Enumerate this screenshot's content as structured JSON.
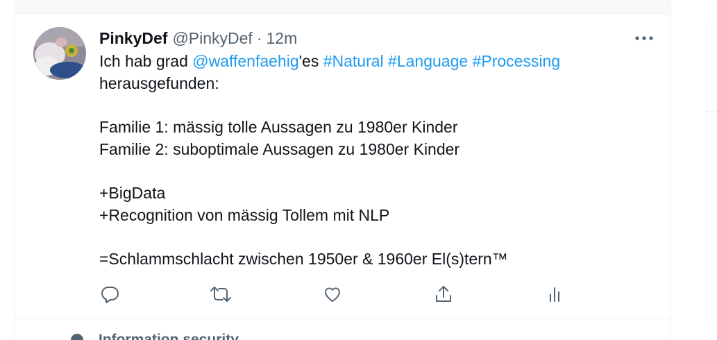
{
  "tweet": {
    "display_name": "PinkyDef",
    "handle": "@PinkyDef",
    "separator": "·",
    "time": "12m",
    "more_icon": "more-dots-icon",
    "body": {
      "line1_prefix": "Ich hab grad ",
      "mention": "@waffenfaehig",
      "line1_mid": "'es ",
      "hashtag1": "#Natural",
      "hashtag2": "#Language",
      "hashtag3": "#Processing",
      "line2": "herausgefunden:",
      "line4": "Familie 1: mässig tolle Aussagen zu 1980er Kinder",
      "line5": "Familie 2: suboptimale Aussagen zu 1980er Kinder",
      "line7": "+BigData",
      "line8": "+Recognition von mässig Tollem mit NLP",
      "line10": "=Schlammschlacht zwischen 1950er & 1960er El(s)tern™"
    },
    "actions": [
      "reply-icon",
      "retweet-icon",
      "like-icon",
      "share-icon",
      "analytics-icon"
    ]
  },
  "next_item": {
    "label": "Information security"
  },
  "colors": {
    "text": "#0f1419",
    "secondary": "#536471",
    "link": "#1d9bf0",
    "border": "#eff3f4"
  }
}
